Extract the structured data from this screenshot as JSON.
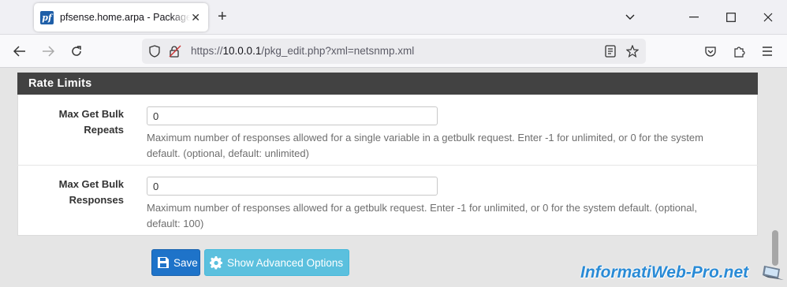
{
  "browser": {
    "tab_title": "pfsense.home.arpa - Package: NetSNMP: Settings",
    "tab_close": "✕",
    "new_tab": "+",
    "url_prefix": "https://",
    "url_host": "10.0.0.1",
    "url_path": "/pkg_edit.php?xml=netsnmp.xml",
    "favicon_text": "pf"
  },
  "section": {
    "title": "Rate Limits"
  },
  "fields": [
    {
      "label_line1": "Max Get Bulk",
      "label_line2": "Repeats",
      "value": "0",
      "help_line1": "Maximum number of responses allowed for a single variable in a getbulk request. Enter -1 for unlimited, or 0 for the system",
      "help_line2": "default. (optional, default: unlimited)"
    },
    {
      "label_line1": "Max Get Bulk",
      "label_line2": "Responses",
      "value": "0",
      "help_line1": "Maximum number of responses allowed for a getbulk request. Enter -1 for unlimited, or 0 for the system default. (optional,",
      "help_line2": "default: 100)"
    }
  ],
  "buttons": {
    "save": "Save",
    "advanced": "Show Advanced Options"
  },
  "watermark": "InformatiWeb-Pro.net",
  "colors": {
    "heading_bg": "#424242",
    "save_btn": "#1e73c9",
    "advanced_btn": "#5bc0de",
    "watermark": "#2a8bd6"
  }
}
